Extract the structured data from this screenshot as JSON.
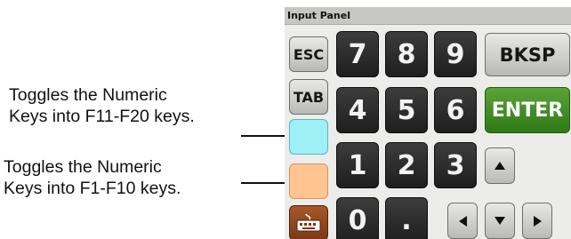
{
  "panel": {
    "title": "Input Panel",
    "keys": {
      "esc": "ESC",
      "tab": "TAB",
      "bksp": "BKSP",
      "enter": "ENTER",
      "seven": "7",
      "eight": "8",
      "nine": "9",
      "four": "4",
      "five": "5",
      "six": "6",
      "one": "1",
      "two": "2",
      "three": "3",
      "zero": "0",
      "dot": "."
    },
    "toggle_colors": {
      "f11_f20": "#9ef0f6",
      "f1_f10": "#ffc48f"
    },
    "icons": {
      "keyboard": "keyboard-icon",
      "up": "arrow-up-icon",
      "down": "arrow-down-icon",
      "left": "arrow-left-icon",
      "right": "arrow-right-icon"
    }
  },
  "annotations": {
    "f11_f20": {
      "line1": "Toggles the Numeric",
      "line2": "Keys into F11-F20 keys."
    },
    "f1_f10": {
      "line1": "Toggles the Numeric",
      "line2": "Keys into F1-F10 keys."
    }
  }
}
